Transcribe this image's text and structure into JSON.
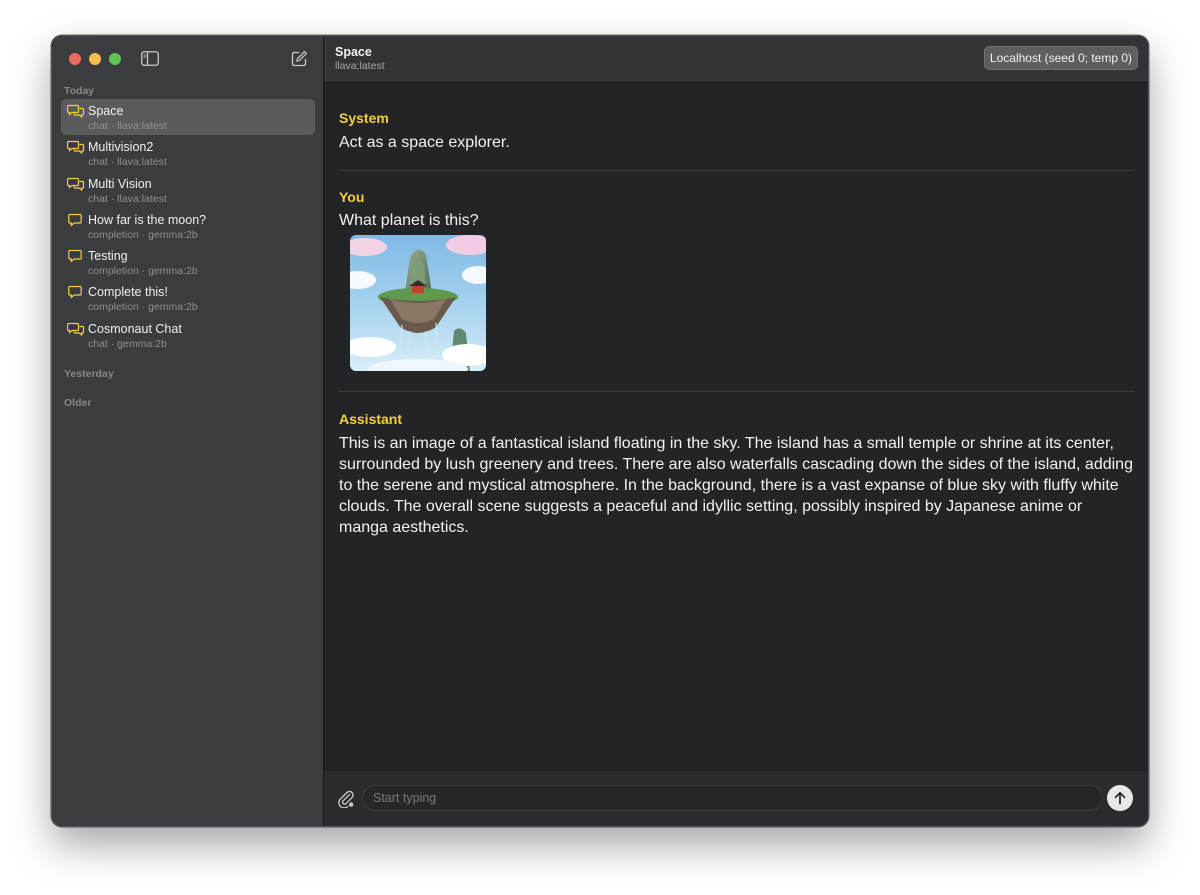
{
  "sidebar": {
    "sections": {
      "today": "Today",
      "yesterday": "Yesterday",
      "older": "Older"
    },
    "items": [
      {
        "title": "Space",
        "subtitle": "chat · llava:latest",
        "icon": "chat-bubbles-icon",
        "selected": true
      },
      {
        "title": "Multivision2",
        "subtitle": "chat · llava:latest",
        "icon": "chat-bubbles-icon",
        "selected": false
      },
      {
        "title": "Multi Vision",
        "subtitle": "chat · llava:latest",
        "icon": "chat-bubbles-icon",
        "selected": false
      },
      {
        "title": "How far is the moon?",
        "subtitle": "completion · gemma:2b",
        "icon": "chat-bubble-icon",
        "selected": false
      },
      {
        "title": "Testing",
        "subtitle": "completion · gemma:2b",
        "icon": "chat-bubble-icon",
        "selected": false
      },
      {
        "title": "Complete this!",
        "subtitle": "completion · gemma:2b",
        "icon": "chat-bubble-icon",
        "selected": false
      },
      {
        "title": "Cosmonaut Chat",
        "subtitle": "chat · gemma:2b",
        "icon": "chat-bubbles-icon",
        "selected": false
      }
    ]
  },
  "header": {
    "title": "Space",
    "subtitle": "llava:latest",
    "host_button": "Localhost (seed 0; temp 0)"
  },
  "messages": [
    {
      "role": "System",
      "text": "Act as a space explorer."
    },
    {
      "role": "You",
      "text": "What planet is this?",
      "image": "floating-island-image"
    },
    {
      "role": "Assistant",
      "text": "This is an image of a fantastical island floating in the sky. The island has a small temple or shrine at its center, surrounded by lush greenery and trees. There are also waterfalls cascading down the sides of the island, adding to the serene and mystical atmosphere. In the background, there is a vast expanse of blue sky with fluffy white clouds. The overall scene suggests a peaceful and idyllic setting, possibly inspired by Japanese anime or manga aesthetics."
    }
  ],
  "composer": {
    "placeholder": "Start typing",
    "value": ""
  },
  "colors": {
    "accent_role": "#f6cf3f",
    "sidebar_bg": "#3b3c3f",
    "main_bg": "#222427",
    "selected_bg": "#5a5b5e"
  }
}
